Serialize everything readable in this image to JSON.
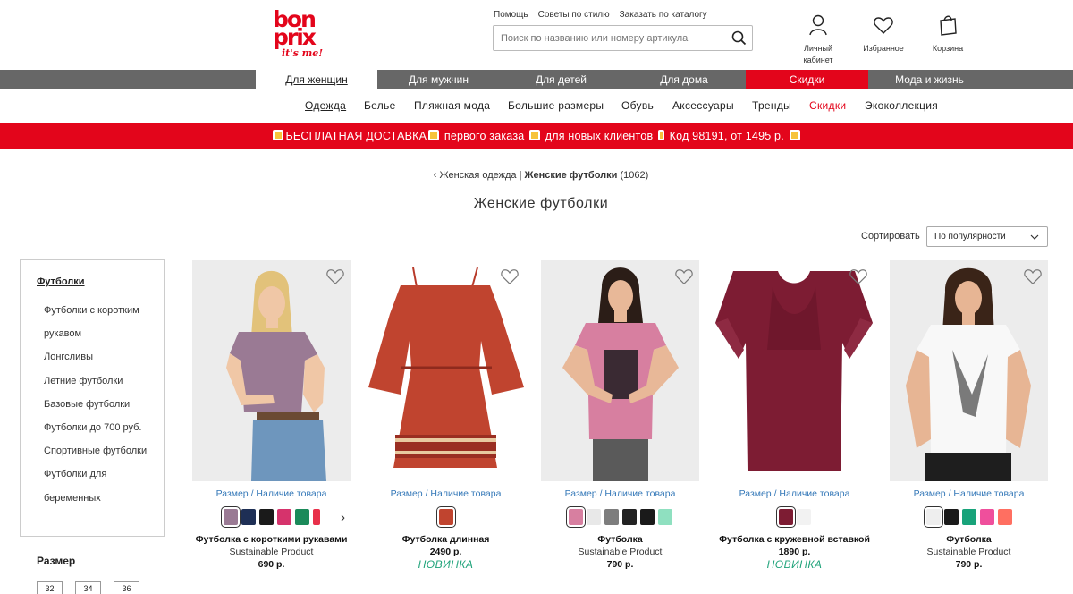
{
  "logo": {
    "line1": "bon",
    "line2": "prix",
    "tagline": "it's me!"
  },
  "header": {
    "service_links": [
      "Помощь",
      "Советы по стилю",
      "Заказать по каталогу"
    ],
    "search_placeholder": "Поиск по названию или номеру артикула",
    "account_label": "Личный кабинет",
    "favorites_label": "Избранное",
    "cart_label": "Корзина"
  },
  "top_nav": [
    "Для женщин",
    "Для мужчин",
    "Для детей",
    "Для дома",
    "Скидки",
    "Мода и жизнь"
  ],
  "sub_nav": [
    "Одежда",
    "Белье",
    "Пляжная мода",
    "Большие размеры",
    "Обувь",
    "Аксессуары",
    "Тренды",
    "Скидки",
    "Экоколлекция"
  ],
  "promo": {
    "text1": "БЕСПЛАТНАЯ ДОСТАВКА",
    "text2": " первого заказа ",
    "text3": " для новых клиентов ",
    "text4": " Код 98191, от 1495 р. "
  },
  "breadcrumb": {
    "parent": "‹ Женская одежда",
    "separator": " | ",
    "current": "Женские футболки",
    "count": " (1062)"
  },
  "page_title": "Женские футболки",
  "sort": {
    "label": "Сортировать",
    "selected": "По популярности"
  },
  "sidebar": {
    "category": "Футболки",
    "items": [
      "Футболки с коротким рукавом",
      "Лонгсливы",
      "Летние футболки",
      "Базовые футболки",
      "Футболки до 700 руб.",
      "Спортивные футболки",
      "Футболки для беременных"
    ],
    "size_title": "Размер",
    "sizes": [
      "32",
      "34",
      "36"
    ]
  },
  "availability_label": "Размер / Наличие товара",
  "products": [
    {
      "name": "Футболка с короткими рукавами",
      "subtitle": "Sustainable Product",
      "price": "690 р.",
      "badge": "",
      "swatches": [
        "#9a7a94",
        "#1e2f55",
        "#1a1a1a",
        "#d6336c",
        "#1b8a5a",
        "#e8304a"
      ]
    },
    {
      "name": "Футболка длинная",
      "subtitle": "",
      "price": "2490 р.",
      "badge": "НОВИНКА",
      "swatches": [
        "#c0442f"
      ]
    },
    {
      "name": "Футболка",
      "subtitle": "Sustainable Product",
      "price": "790 р.",
      "badge": "",
      "swatches": [
        "#d77fa0",
        "#e8e8e8",
        "#7d7d7d",
        "#222222",
        "#1a1a1a",
        "#8fe0c0"
      ]
    },
    {
      "name": "Футболка с кружевной вставкой",
      "subtitle": "",
      "price": "1890 р.",
      "badge": "НОВИНКА",
      "swatches": [
        "#7d1c33",
        "#f2f2f2"
      ]
    },
    {
      "name": "Футболка",
      "subtitle": "Sustainable Product",
      "price": "790 р.",
      "badge": "",
      "swatches": [
        "#eeeeee",
        "#1a1a1a",
        "#18a37a",
        "#ef4f9c",
        "#ff6f61"
      ]
    }
  ]
}
